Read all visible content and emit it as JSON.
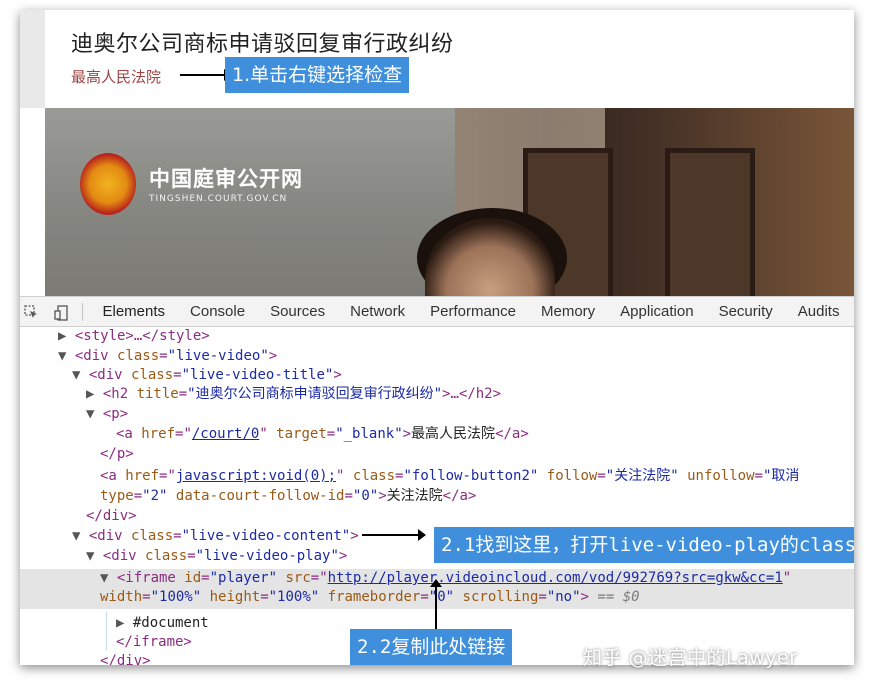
{
  "page": {
    "title": "迪奥尔公司商标申请驳回复审行政纠纷",
    "court": "最高人民法院"
  },
  "video": {
    "logo_cn": "中国庭审公开网",
    "logo_en": "TINGSHEN.COURT.GOV.CN"
  },
  "annotations": {
    "step1": "1.单击右键选择检查",
    "step2_1": "2.1找到这里，打开live-video-play的class",
    "step2_2": "2.2复制此处链接",
    "accent_color": "#3f8fdc"
  },
  "devtools": {
    "tabs": [
      "Elements",
      "Console",
      "Sources",
      "Network",
      "Performance",
      "Memory",
      "Application",
      "Security",
      "Audits"
    ],
    "active_tab": "Elements",
    "icons": [
      "inspect-cursor-icon",
      "device-toggle-icon"
    ]
  },
  "dom": {
    "l0": "<style>…</style>",
    "l1_tag": "div",
    "l1_attr": "class",
    "l1_val": "\"live-video\"",
    "l2_val": "\"live-video-title\"",
    "l3_attr": "title",
    "l3_val": "\"迪奥尔公司商标申请驳回复审行政纠纷\"",
    "l5_href": "/court/0",
    "l5_target": "\"_blank\"",
    "l5_text": "最高人民法院",
    "l7_href": "javascript:void(0);",
    "l7_class": "\"follow-button2\"",
    "l7_follow": "\"关注法院\"",
    "l7_unfollow": "\"取消",
    "l8_type": "\"2\"",
    "l8_court_id": "\"0\"",
    "l8_text": "关注法院",
    "l10_val": "\"live-video-content\"",
    "l11_val": "\"live-video-play\"",
    "l12_id": "\"player\"",
    "l12_src": "http://player.videoincloud.com/vod/992769?src=gkw&cc=1",
    "l13_width": "\"100%\"",
    "l13_height": "\"100%\"",
    "l13_frameborder": "\"0\"",
    "l13_scrolling": "\"no\"",
    "l13_eq": "== $0",
    "l14": "#document"
  },
  "watermark": "知乎 @迷宫中的Lawyer"
}
